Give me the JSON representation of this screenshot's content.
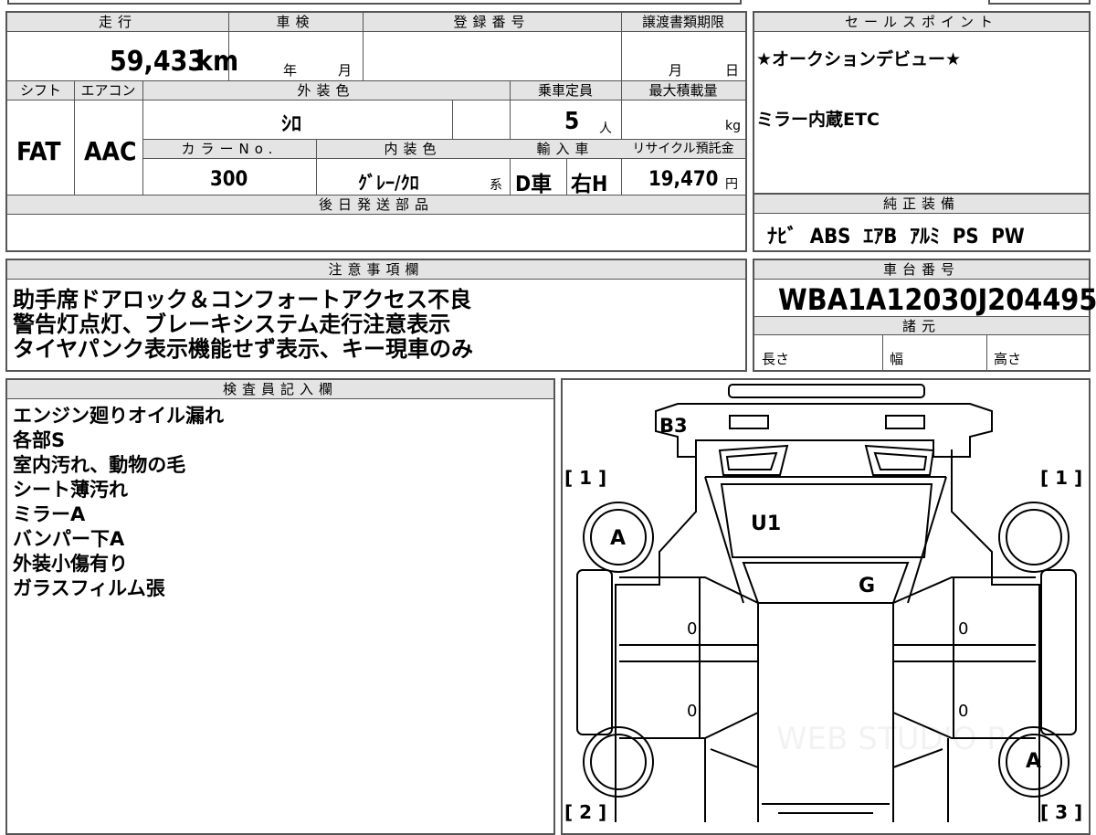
{
  "spec": {
    "mileage_label": "走行",
    "mileage_value": "59,433",
    "mileage_unit": "km",
    "shaken_label": "車検",
    "shaken_year_unit": "年",
    "shaken_month_unit": "月",
    "registration_label": "登録番号",
    "transfer_deadline_label": "譲渡書類期限",
    "transfer_month_unit": "月",
    "transfer_day_unit": "日",
    "shift_label": "シフト",
    "shift_value": "FAT",
    "ac_label": "エアコン",
    "ac_value": "AAC",
    "exterior_color_label": "外装色",
    "exterior_color_value": "ｼﾛ",
    "capacity_label": "乗車定員",
    "capacity_value": "5",
    "capacity_unit": "人",
    "max_load_label": "最大積載量",
    "max_load_unit": "kg",
    "color_no_label": "カラーNo.",
    "color_no_value": "300",
    "interior_color_label": "内装色",
    "interior_color_value": "ｸﾞﾚｰ/ｸﾛ",
    "interior_color_suffix": "系",
    "import_label": "輸入車",
    "import_value": "D車",
    "steering_value": "右H",
    "recycle_label": "リサイクル預託金",
    "recycle_value": "19,470",
    "recycle_unit": "円",
    "later_parts_label": "後日発送部品"
  },
  "sales_points": {
    "label": "セールスポイント",
    "lines": [
      "★オークションデビュー★",
      "ミラー内蔵ETC"
    ]
  },
  "equipment": {
    "label": "純正装備",
    "value": "ﾅﾋﾞ  ABS  ｴｱB  ｱﾙﾐ  PS  PW"
  },
  "notes": {
    "label": "注意事項欄",
    "lines": [
      "助手席ドアロック＆コンフォートアクセス不良",
      "警告灯点灯、ブレーキシステム走行注意表示",
      "タイヤパンク表示機能せず表示、キー現車のみ"
    ]
  },
  "chassis": {
    "label": "車台番号",
    "value": "WBA1A12030J204495"
  },
  "dimensions": {
    "label": "諸元",
    "length_label": "長さ",
    "width_label": "幅",
    "height_label": "高さ"
  },
  "inspector": {
    "label": "検査員記入欄",
    "lines": [
      "エンジン廻りオイル漏れ",
      "各部S",
      "室内汚れ、動物の毛",
      "シート薄汚れ",
      "ミラーA",
      "バンパー下A",
      "外装小傷有り",
      "ガラスフィルム張"
    ]
  },
  "diagram": {
    "marks": {
      "rear": "B3",
      "windshield": "U1",
      "glass_roof": "G",
      "front_left_tire": "A",
      "rear_right_tire": "A",
      "door_fl": "0",
      "door_rl": "0",
      "door_fr": "0",
      "door_rr": "0"
    },
    "tread": {
      "front_left": "[ 1 ]",
      "front_right": "[ 1 ]",
      "rear_left": "[ 2 ]",
      "rear_right": "[ 3 ]"
    },
    "watermark": "WEB STUDIO P"
  }
}
